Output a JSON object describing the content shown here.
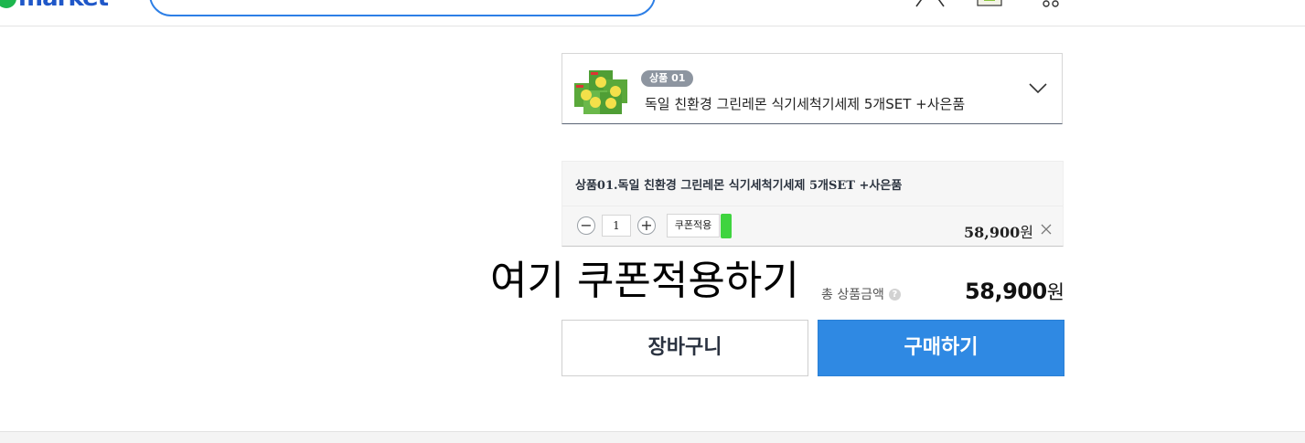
{
  "header": {
    "logo_text": "market",
    "icons": [
      "user-icon",
      "cart-icon",
      "recent-view-icon",
      "search-icon"
    ]
  },
  "option_select": {
    "badge": "상품 01",
    "name": "독일 친환경 그린레몬 식기세척기세제 5개SET +사은품",
    "chevron_icon": "chevron-down-icon"
  },
  "selected_item": {
    "title": "상품01.독일 친환경 그린레몬 식기세척기세제 5개SET +사은품",
    "quantity": "1",
    "minus_symbol": "−",
    "plus_symbol": "+",
    "coupon_label": "쿠폰적용",
    "price": "58,900",
    "currency": "원",
    "remove_icon": "close-icon"
  },
  "annotation": "여기 쿠폰적용하기",
  "total": {
    "label": "총 상품금액",
    "help_symbol": "?",
    "price": "58,900",
    "currency": "원"
  },
  "actions": {
    "cart_label": "장바구니",
    "buy_label": "구매하기"
  },
  "colors": {
    "brand_blue": "#2f89e3",
    "logo_green": "#1db64e",
    "coupon_marker": "#3fd43f",
    "search_border": "#2d7fe6"
  }
}
